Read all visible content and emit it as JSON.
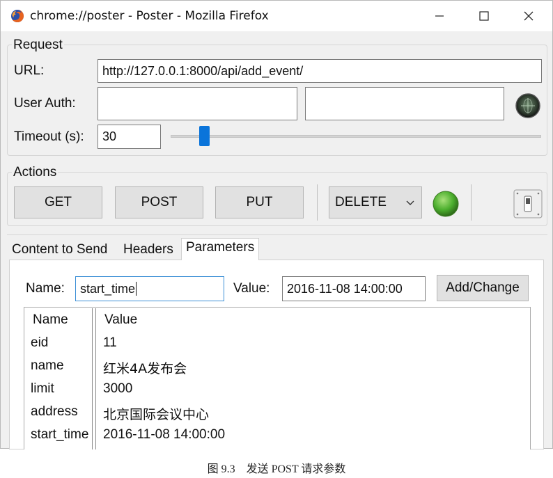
{
  "window": {
    "title": "chrome://poster - Poster - Mozilla Firefox",
    "app_icon": "firefox-icon",
    "controls": {
      "minimize": "—",
      "maximize": "☐",
      "close": "✕"
    }
  },
  "request": {
    "group_title": "Request",
    "url_label": "URL:",
    "url_value": "http://127.0.0.1:8000/api/add_event/",
    "user_auth_label": "User Auth:",
    "user_value": "",
    "password_value": "",
    "timeout_label": "Timeout (s):",
    "timeout_value": "30",
    "timeout_slider_level": 0.08,
    "auth_icon": "globe-icon"
  },
  "actions": {
    "group_title": "Actions",
    "get_label": "GET",
    "post_label": "POST",
    "put_label": "PUT",
    "method_selected": "DELETE",
    "status_color": "#4caf2e",
    "toggle_icon": "switch-icon"
  },
  "tabs": [
    {
      "label": "Content to Send",
      "active": false
    },
    {
      "label": "Headers",
      "active": false
    },
    {
      "label": "Parameters",
      "active": true
    }
  ],
  "parameters": {
    "name_label": "Name:",
    "name_value": "start_time",
    "value_label": "Value:",
    "value_value": "2016-11-08 14:00:00",
    "add_button": "Add/Change",
    "columns": [
      "Name",
      "Value"
    ],
    "rows": [
      {
        "name": "eid",
        "value": "11"
      },
      {
        "name": "name",
        "value": "红米4A发布会"
      },
      {
        "name": "limit",
        "value": "3000"
      },
      {
        "name": "address",
        "value": "北京国际会议中心"
      },
      {
        "name": "start_time",
        "value": "2016-11-08 14:00:00"
      }
    ]
  },
  "caption": "图 9.3　发送 POST 请求参数"
}
